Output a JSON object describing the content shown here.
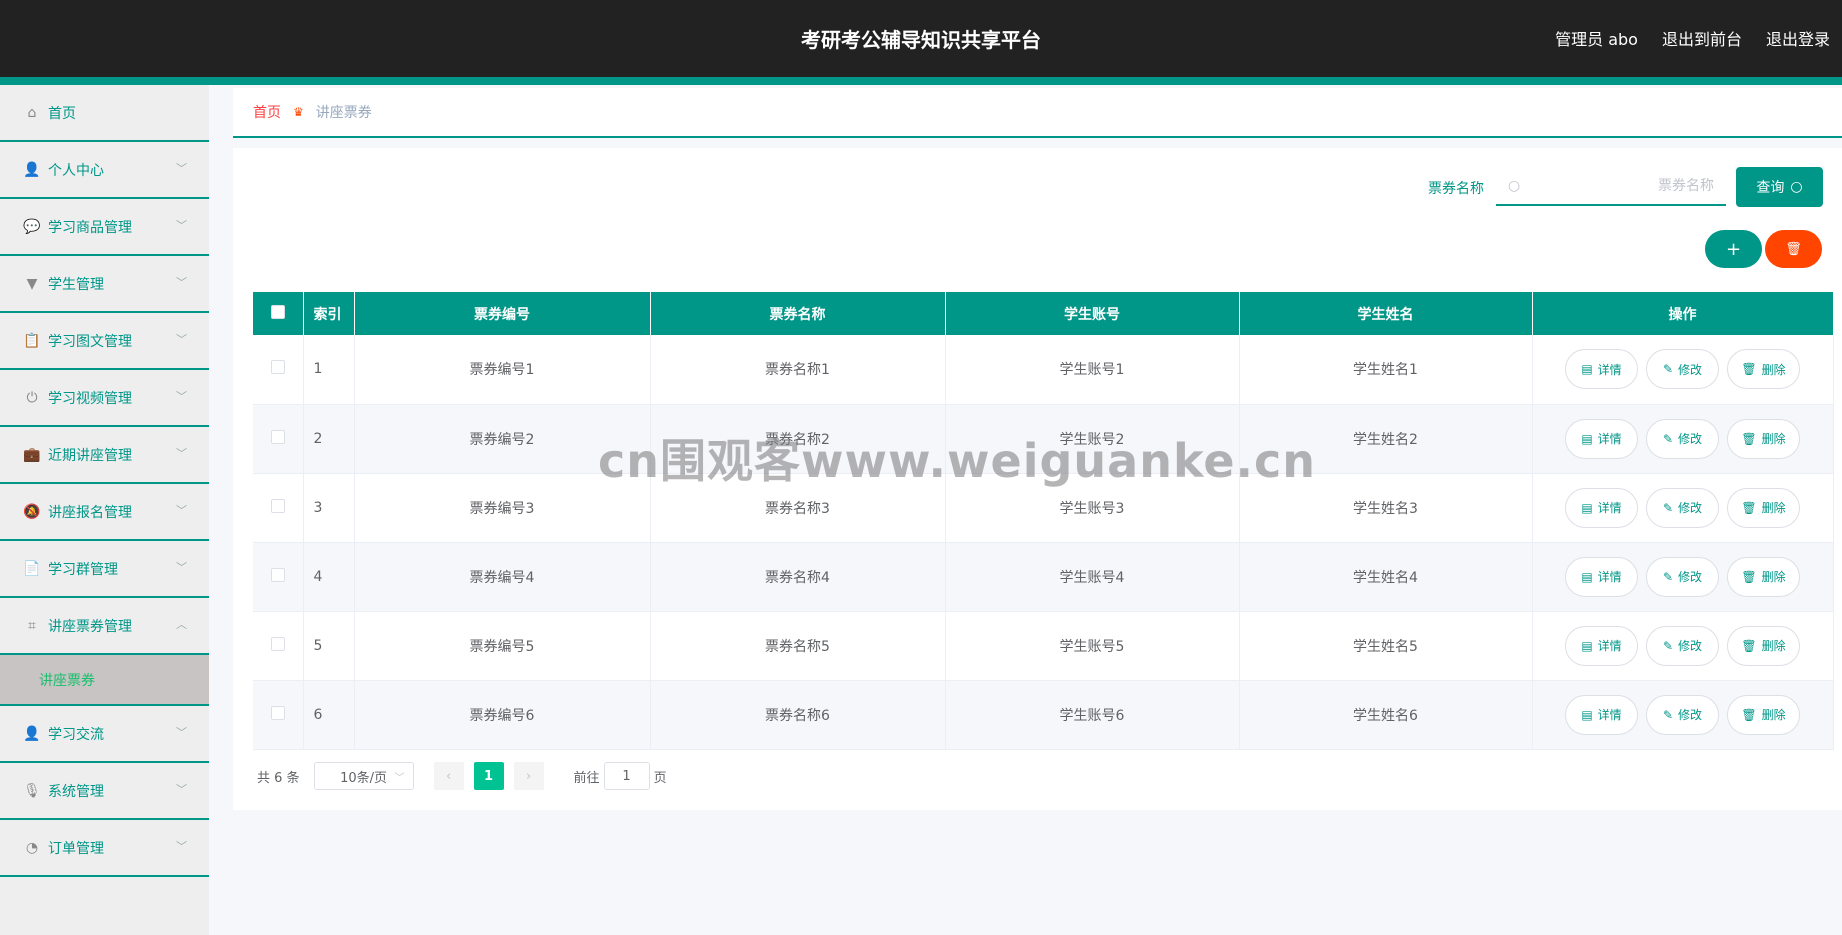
{
  "header": {
    "title": "考研考公辅导知识共享平台",
    "user": "管理员 abo",
    "to_front": "退出到前台",
    "logout": "退出登录"
  },
  "sidebar": {
    "items": [
      {
        "label": "首页",
        "icon": "home-icon"
      },
      {
        "label": "个人中心",
        "icon": "user-icon"
      },
      {
        "label": "学习商品管理",
        "icon": "chat-icon"
      },
      {
        "label": "学生管理",
        "icon": "brush-icon"
      },
      {
        "label": "学习图文管理",
        "icon": "clipboard-check-icon"
      },
      {
        "label": "学习视频管理",
        "icon": "power-icon"
      },
      {
        "label": "近期讲座管理",
        "icon": "briefcase-icon"
      },
      {
        "label": "讲座报名管理",
        "icon": "bell-off-icon"
      },
      {
        "label": "学习群管理",
        "icon": "document-icon"
      },
      {
        "label": "讲座票券管理",
        "icon": "crop-icon",
        "expanded": true,
        "children": [
          {
            "label": "讲座票券",
            "active": true
          }
        ]
      },
      {
        "label": "学习交流",
        "icon": "user-stamp-icon"
      },
      {
        "label": "系统管理",
        "icon": "microphone-icon"
      },
      {
        "label": "订单管理",
        "icon": "gauge-icon"
      }
    ]
  },
  "breadcrumb": {
    "home": "首页",
    "current": "讲座票券"
  },
  "search": {
    "label": "票券名称",
    "placeholder": "票券名称",
    "value": "",
    "button": "查询"
  },
  "table": {
    "columns": [
      "索引",
      "票券编号",
      "票券名称",
      "学生账号",
      "学生姓名",
      "操作"
    ],
    "rows": [
      {
        "index": "1",
        "code": "票券编号1",
        "name": "票券名称1",
        "account": "学生账号1",
        "student": "学生姓名1"
      },
      {
        "index": "2",
        "code": "票券编号2",
        "name": "票券名称2",
        "account": "学生账号2",
        "student": "学生姓名2"
      },
      {
        "index": "3",
        "code": "票券编号3",
        "name": "票券名称3",
        "account": "学生账号3",
        "student": "学生姓名3"
      },
      {
        "index": "4",
        "code": "票券编号4",
        "name": "票券名称4",
        "account": "学生账号4",
        "student": "学生姓名4"
      },
      {
        "index": "5",
        "code": "票券编号5",
        "name": "票券名称5",
        "account": "学生账号5",
        "student": "学生姓名5"
      },
      {
        "index": "6",
        "code": "票券编号6",
        "name": "票券名称6",
        "account": "学生账号6",
        "student": "学生姓名6"
      }
    ],
    "actions": {
      "detail": "详情",
      "edit": "修改",
      "delete": "删除"
    }
  },
  "pagination": {
    "total": "共 6 条",
    "page_size": "10条/页",
    "current": "1",
    "goto_label": "前往",
    "goto_value": "1",
    "page_suffix": "页"
  },
  "watermark": "cn围观客www.weiguanke.cn",
  "colors": {
    "accent": "#009688",
    "danger": "#ff4500",
    "header_bg": "#222222",
    "active_page": "#00c292"
  }
}
